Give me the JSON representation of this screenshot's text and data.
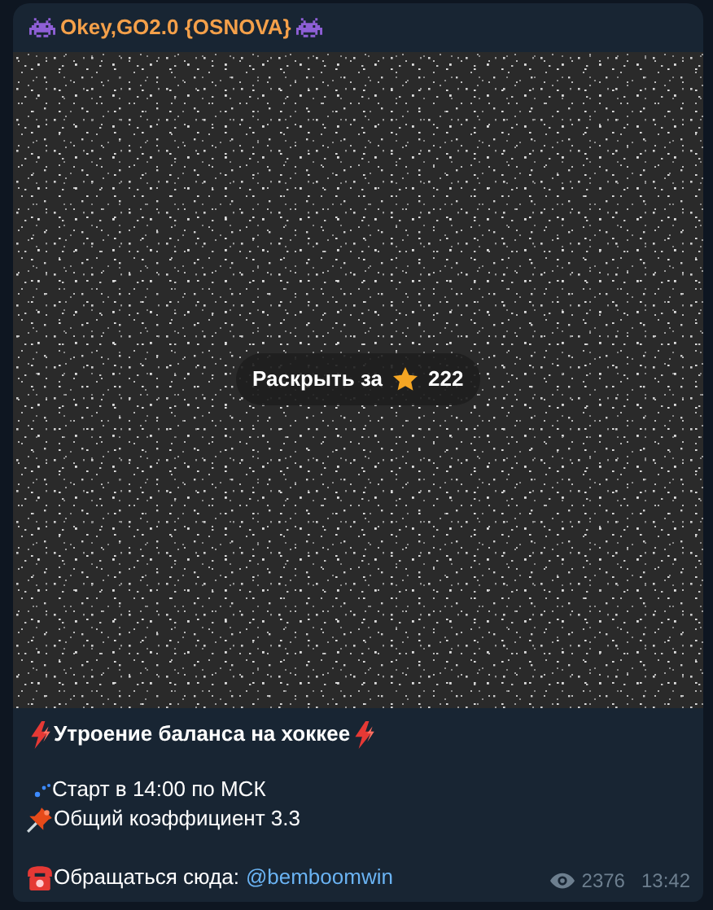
{
  "channel": {
    "title": "Okey,GO2.0 {OSNOVA}"
  },
  "media": {
    "kind": "picture",
    "unlock_button": {
      "label": "Раскрыть за",
      "price": "222"
    }
  },
  "message": {
    "lines": [
      {
        "kind": "heading",
        "text": "Утроение баланса на хоккее"
      },
      {
        "kind": "start",
        "text": "Старт в 14:00 по МСК"
      },
      {
        "kind": "odds",
        "text": "Общий коэффициент 3.3"
      },
      {
        "kind": "contact",
        "text": "Обращаться сюда:",
        "link": "@bemboomwin"
      }
    ]
  },
  "footer": {
    "views": "2376",
    "time": "13:42"
  }
}
